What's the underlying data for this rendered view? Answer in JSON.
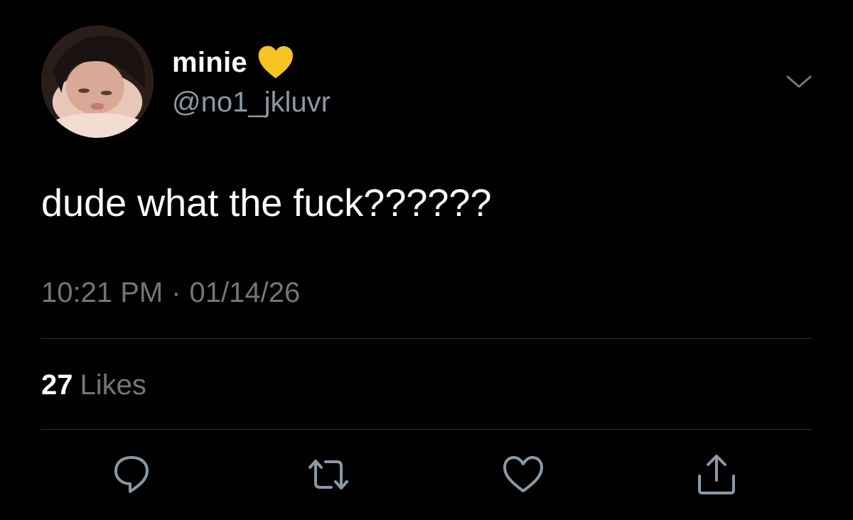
{
  "user": {
    "display_name": "minie",
    "handle": "@no1_jkluvr",
    "name_emoji": "yellow-heart-icon"
  },
  "tweet": {
    "text": "dude what the fuck??????",
    "time": "10:21 PM",
    "separator": "·",
    "date": "01/14/26"
  },
  "stats": {
    "likes_count": "27",
    "likes_label": "Likes"
  },
  "actions": {
    "icons": [
      "reply-icon",
      "retweet-icon",
      "like-icon",
      "share-icon"
    ]
  },
  "colors": {
    "background": "#000000",
    "primary_text": "#ffffff",
    "secondary_text": "#71767b",
    "divider": "#2f3336",
    "icon": "#8b98a5",
    "heart_emoji": "#f7c325"
  }
}
